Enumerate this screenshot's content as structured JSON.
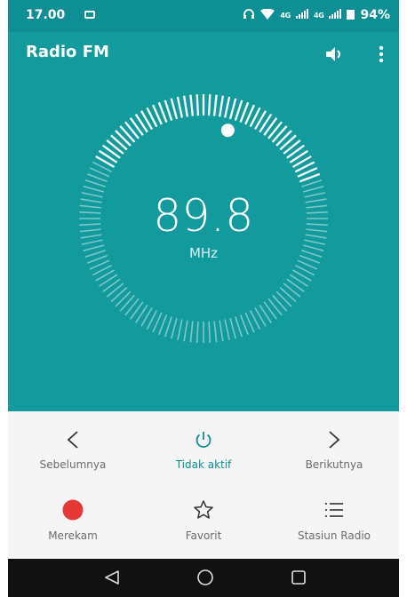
{
  "status_bar": {
    "time": "17.00",
    "network_label_1": "4G",
    "network_label_2": "4G",
    "battery_percent": "94%"
  },
  "app_bar": {
    "title": "Radio FM",
    "speaker_icon": "speaker-icon",
    "menu_icon": "more-vert-icon"
  },
  "tuner": {
    "frequency": "89.8",
    "unit": "MHz",
    "dial_position": 0.58
  },
  "controls": {
    "previous": {
      "label": "Sebelumnya",
      "icon": "chevron-left-icon"
    },
    "power": {
      "label": "Tidak aktif",
      "icon": "power-icon"
    },
    "next": {
      "label": "Berikutnya",
      "icon": "chevron-right-icon"
    },
    "record": {
      "label": "Merekam",
      "icon": "record-icon"
    },
    "favorite": {
      "label": "Favorit",
      "icon": "star-icon"
    },
    "stations": {
      "label": "Stasiun Radio",
      "icon": "list-icon"
    }
  },
  "colors": {
    "primary": "#139a9d",
    "primary_dark": "#0e8f93",
    "record": "#e53935"
  },
  "nav": {
    "back_icon": "back-icon",
    "home_icon": "home-icon",
    "recents_icon": "recents-icon"
  }
}
